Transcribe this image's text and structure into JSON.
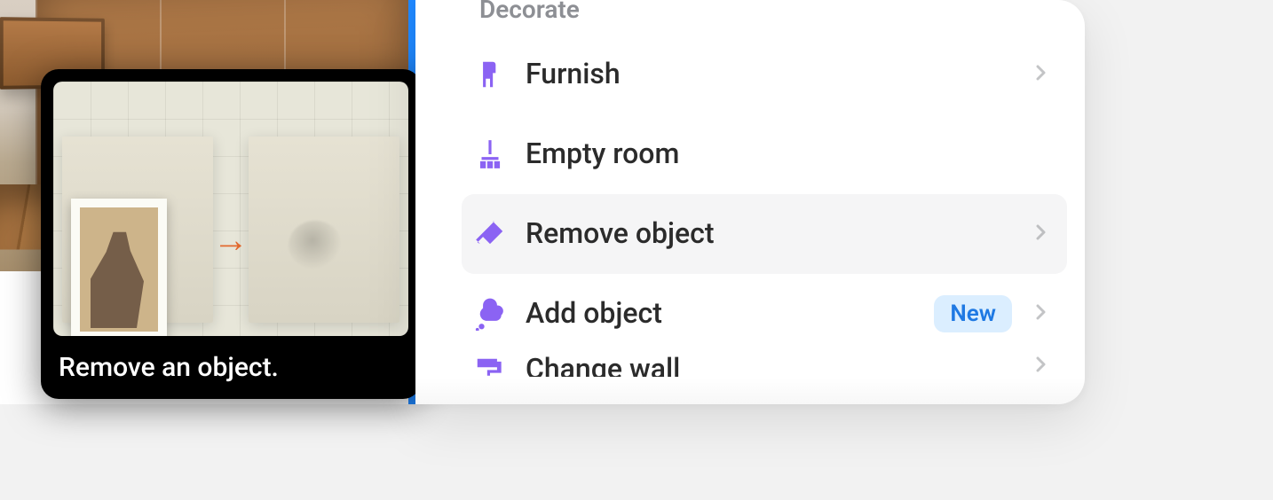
{
  "tooltip": {
    "caption": "Remove an object."
  },
  "section": {
    "title": "Decorate"
  },
  "menu": {
    "furnish": {
      "label": "Furnish",
      "icon": "chair-icon",
      "badge": null
    },
    "empty_room": {
      "label": "Empty room",
      "icon": "broom-icon",
      "badge": null
    },
    "remove_object": {
      "label": "Remove object",
      "icon": "eraser-icon",
      "badge": null
    },
    "add_object": {
      "label": "Add object",
      "icon": "thought-icon",
      "badge": "New"
    },
    "change_wall": {
      "label": "Change wall",
      "icon": "roller-icon",
      "badge": null
    }
  },
  "colors": {
    "accent_icon": "#8b63f3",
    "badge_bg": "#dbeeff",
    "badge_text": "#1f79e3"
  }
}
